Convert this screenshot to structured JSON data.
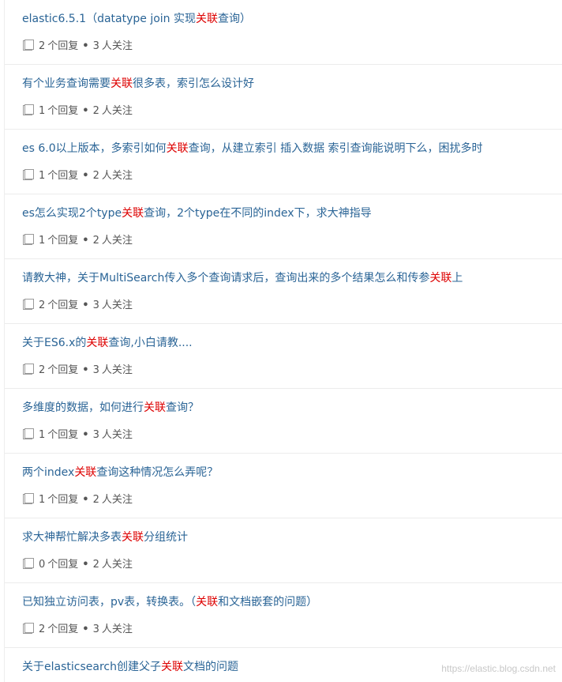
{
  "questions": [
    {
      "title_parts": [
        {
          "t": "elastic6.5.1（datatype join 实现"
        },
        {
          "t": "关联",
          "hl": true
        },
        {
          "t": "查询）"
        }
      ],
      "replies": "2",
      "reply_label": "个回复",
      "sep": "•",
      "followers": "3",
      "follow_label": "人关注"
    },
    {
      "title_parts": [
        {
          "t": "有个业务查询需要"
        },
        {
          "t": "关联",
          "hl": true
        },
        {
          "t": "很多表，索引怎么设计好"
        }
      ],
      "replies": "1",
      "reply_label": "个回复",
      "sep": "•",
      "followers": "2",
      "follow_label": "人关注"
    },
    {
      "title_parts": [
        {
          "t": "es 6.0以上版本，多索引如何"
        },
        {
          "t": "关联",
          "hl": true
        },
        {
          "t": "查询，从建立索引 插入数据 索引查询能说明下么，困扰多时"
        }
      ],
      "replies": "1",
      "reply_label": "个回复",
      "sep": "•",
      "followers": "2",
      "follow_label": "人关注"
    },
    {
      "title_parts": [
        {
          "t": "es怎么实现2个type"
        },
        {
          "t": "关联",
          "hl": true
        },
        {
          "t": "查询，2个type在不同的index下，求大神指导"
        }
      ],
      "replies": "1",
      "reply_label": "个回复",
      "sep": "•",
      "followers": "2",
      "follow_label": "人关注"
    },
    {
      "title_parts": [
        {
          "t": "请教大神，关于MultiSearch传入多个查询请求后，查询出来的多个结果怎么和传参"
        },
        {
          "t": "关联",
          "hl": true
        },
        {
          "t": "上"
        }
      ],
      "replies": "2",
      "reply_label": "个回复",
      "sep": "•",
      "followers": "3",
      "follow_label": "人关注"
    },
    {
      "title_parts": [
        {
          "t": "关于ES6.x的"
        },
        {
          "t": "关联",
          "hl": true
        },
        {
          "t": "查询,小白请教...."
        }
      ],
      "replies": "2",
      "reply_label": "个回复",
      "sep": "•",
      "followers": "3",
      "follow_label": "人关注"
    },
    {
      "title_parts": [
        {
          "t": "多维度的数据，如何进行"
        },
        {
          "t": "关联",
          "hl": true
        },
        {
          "t": "查询？"
        }
      ],
      "replies": "1",
      "reply_label": "个回复",
      "sep": "•",
      "followers": "3",
      "follow_label": "人关注"
    },
    {
      "title_parts": [
        {
          "t": "两个index"
        },
        {
          "t": "关联",
          "hl": true
        },
        {
          "t": "查询这种情况怎么弄呢？"
        }
      ],
      "replies": "1",
      "reply_label": "个回复",
      "sep": "•",
      "followers": "2",
      "follow_label": "人关注"
    },
    {
      "title_parts": [
        {
          "t": "求大神帮忙解决多表"
        },
        {
          "t": "关联",
          "hl": true
        },
        {
          "t": "分组统计"
        }
      ],
      "replies": "0",
      "reply_label": "个回复",
      "sep": "•",
      "followers": "2",
      "follow_label": "人关注"
    },
    {
      "title_parts": [
        {
          "t": "已知独立访问表，pv表，转换表。（"
        },
        {
          "t": "关联",
          "hl": true
        },
        {
          "t": "和文档嵌套的问题）"
        }
      ],
      "replies": "2",
      "reply_label": "个回复",
      "sep": "•",
      "followers": "3",
      "follow_label": "人关注"
    },
    {
      "title_parts": [
        {
          "t": "关于elasticsearch创建父子"
        },
        {
          "t": "关联",
          "hl": true
        },
        {
          "t": "文档的问题"
        }
      ]
    }
  ],
  "watermark": "https://elastic.blog.csdn.net",
  "colors": {
    "link": "#2a6496",
    "highlight": "#dd0000",
    "meta": "#555555"
  },
  "icons": {
    "meta_icon": "book-icon"
  }
}
